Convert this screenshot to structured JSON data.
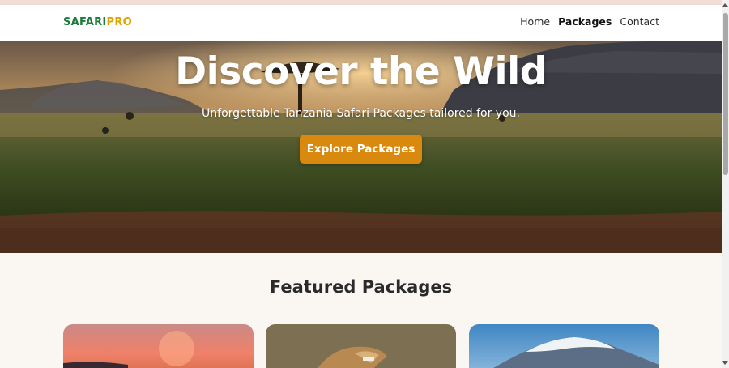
{
  "brand": {
    "part1": "SAFARI",
    "part2": "PRO"
  },
  "nav": {
    "items": [
      {
        "label": "Home",
        "active": false
      },
      {
        "label": "Packages",
        "active": true
      },
      {
        "label": "Contact",
        "active": false
      }
    ]
  },
  "hero": {
    "title": "Discover the Wild",
    "subtitle": "Unforgettable Tanzania Safari Packages tailored for you.",
    "cta_label": "Explore Packages"
  },
  "featured": {
    "title": "Featured Packages",
    "cards": [
      {
        "image": "sunset-savanna-image"
      },
      {
        "image": "lion-image"
      },
      {
        "image": "kilimanjaro-image"
      }
    ]
  },
  "colors": {
    "brand_green": "#1e7a3c",
    "brand_yellow": "#e0a300",
    "cta": "#d98a0e"
  }
}
